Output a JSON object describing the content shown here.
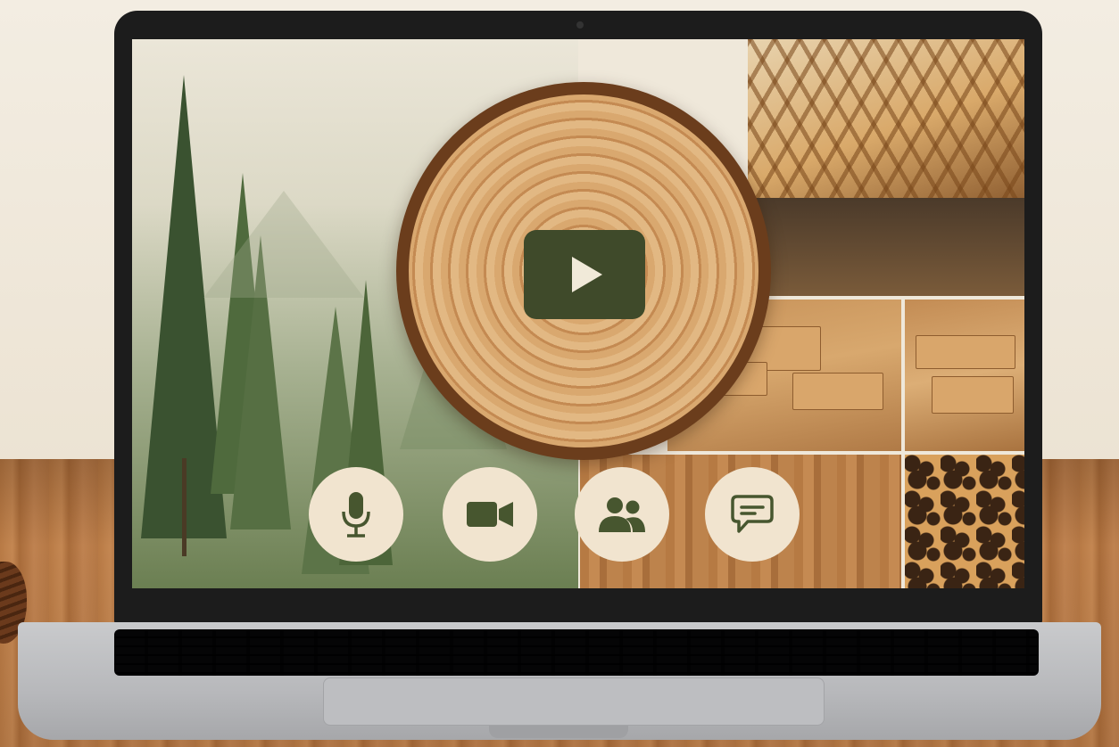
{
  "colors": {
    "icon": "#47562f",
    "button_bg": "#f1e4cf",
    "play_bg": "#3f4a2a",
    "play_glyph": "#f1ead9",
    "bezel": "#1c1c1c"
  },
  "video": {
    "play_icon": "play-icon"
  },
  "controls": [
    {
      "id": "microphone",
      "icon": "microphone-icon"
    },
    {
      "id": "camera",
      "icon": "video-camera-icon"
    },
    {
      "id": "participants",
      "icon": "participants-icon"
    },
    {
      "id": "chat",
      "icon": "chat-bubble-icon"
    }
  ]
}
